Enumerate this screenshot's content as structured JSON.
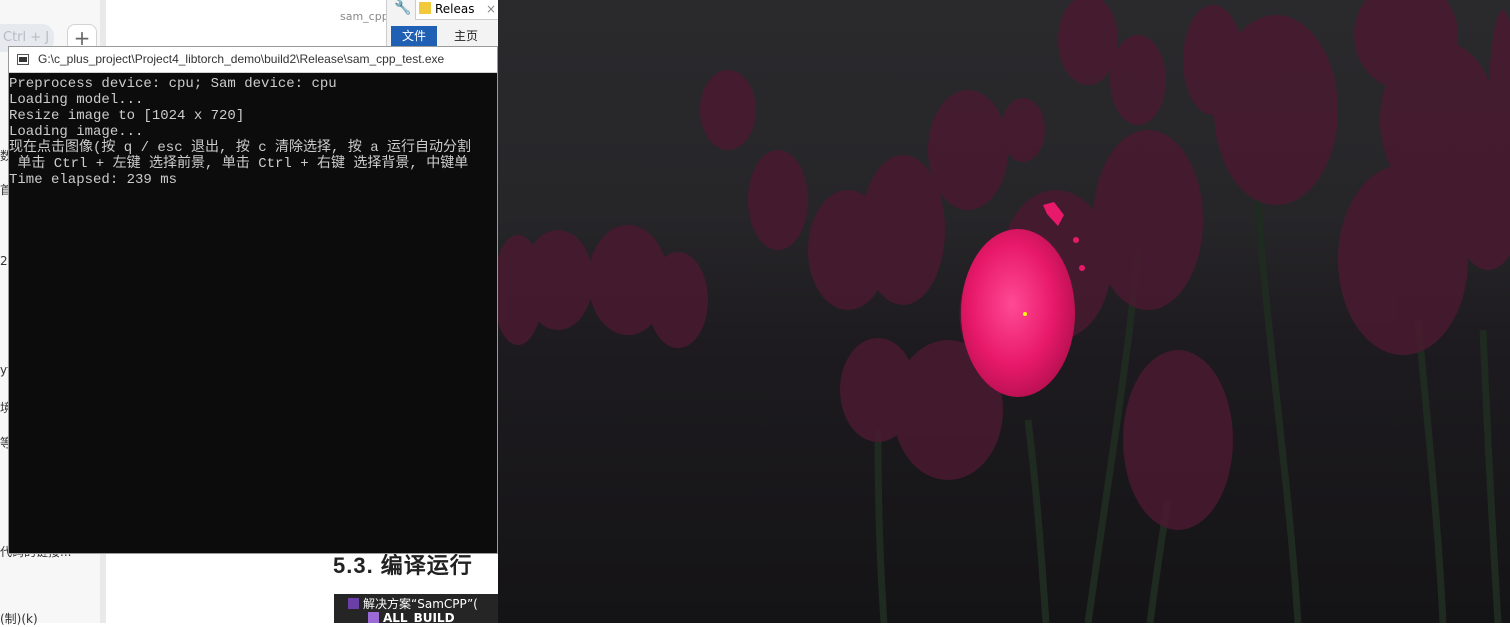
{
  "background": {
    "left_panel": {
      "tab_label": "Ctrl + J",
      "plus_label": "+",
      "fragments": [
        "数",
        "首",
        "2",
        "yt",
        "境",
        "等",
        "代码的链接...",
        "(制)(k)"
      ]
    },
    "doc": {
      "tab_fragment": "sam_cpp",
      "section_heading": "5.3. 编译运行",
      "vs_solution_label": "解决方案“SamCPP”(",
      "vs_project_label": "ALL_BUILD"
    },
    "explorer": {
      "tab_label": "Releas",
      "close_glyph": "×",
      "ribbon_file": "文件",
      "ribbon_home": "主页",
      "wrench_glyph": "🔧"
    }
  },
  "console": {
    "title": "G:\\c_plus_project\\Project4_libtorch_demo\\build2\\Release\\sam_cpp_test.exe",
    "lines": [
      "Preprocess device: cpu; Sam device: cpu",
      "Loading model...",
      "Resize image to [1024 x 720]",
      "Loading image...",
      "现在点击图像(按 q / esc 退出, 按 c 清除选择, 按 a 运行自动分割",
      " 单击 Ctrl + 左键 选择前景, 单击 Ctrl + 右键 选择背景, 中键单",
      "Time elapsed: 239 ms"
    ]
  },
  "image_view": {
    "description_icon": "tulip-image",
    "highlight_color": "#e8196a",
    "background_dim_color": "#1c1a1e",
    "point_marker_color": "#ffff00"
  }
}
